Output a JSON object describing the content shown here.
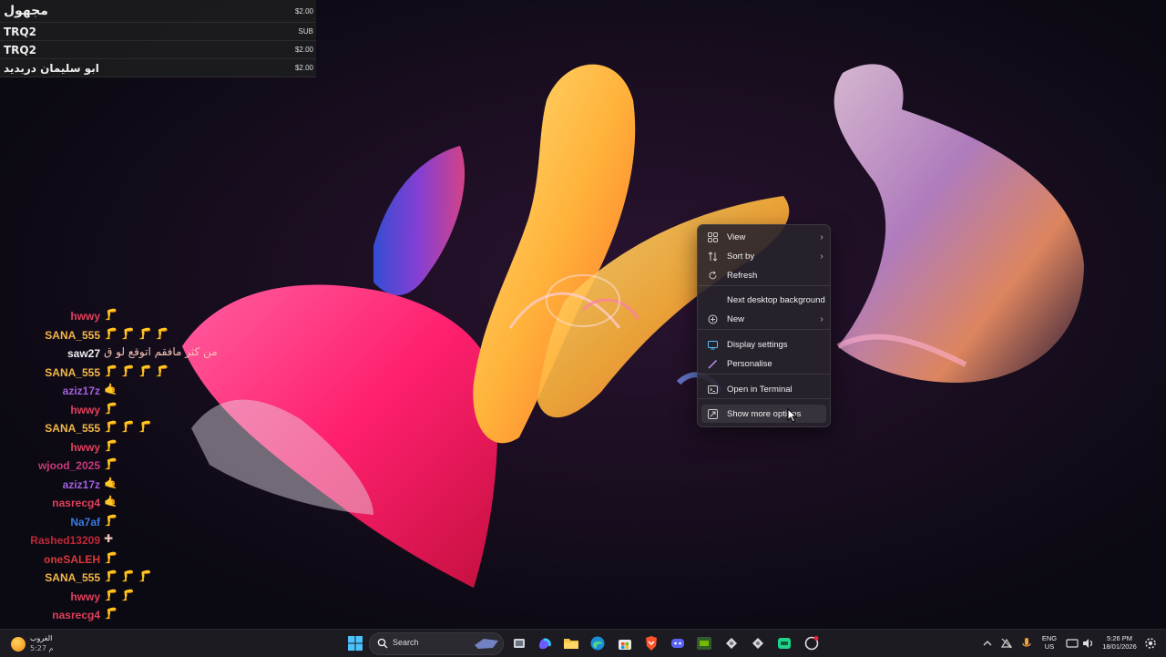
{
  "donations": [
    {
      "name": "مجهول",
      "amount": "$2.00"
    },
    {
      "name": "TRQ2",
      "amount": "SUB"
    },
    {
      "name": "TRQ2",
      "amount": "$2.00"
    },
    {
      "name": "ابو سليمان دربديد",
      "amount": "$2.00"
    }
  ],
  "chat": [
    {
      "user": "hwwy",
      "color": "#e0405c",
      "msg": "🦵"
    },
    {
      "user": "SANA_555",
      "color": "#f3b64a",
      "msg": "🦵 🦵 🦵 🦵"
    },
    {
      "user": "saw27",
      "color": "#eeeeee",
      "msg": "من كثر مافقم اتوقع لو ق"
    },
    {
      "user": "SANA_555",
      "color": "#f3b64a",
      "msg": "🦵 🦵 🦵 🦵"
    },
    {
      "user": "aziz17z",
      "color": "#a35ee0",
      "msg": "🤙"
    },
    {
      "user": "hwwy",
      "color": "#e0405c",
      "msg": "🦵"
    },
    {
      "user": "SANA_555",
      "color": "#f3b64a",
      "msg": "🦵 🦵 🦵"
    },
    {
      "user": "hwwy",
      "color": "#e0405c",
      "msg": "🦵"
    },
    {
      "user": "wjood_2025",
      "color": "#c83a7a",
      "msg": "🦵"
    },
    {
      "user": "aziz17z",
      "color": "#a35ee0",
      "msg": "🤙"
    },
    {
      "user": "nasrecg4",
      "color": "#e0405c",
      "msg": "🤙"
    },
    {
      "user": "Na7af",
      "color": "#3a7ae0",
      "msg": "🦵"
    },
    {
      "user": "Rashed13209",
      "color": "#c02838",
      "msg": "✚"
    },
    {
      "user": "oneSALEH",
      "color": "#d83a3a",
      "msg": "🦵"
    },
    {
      "user": "SANA_555",
      "color": "#f3b64a",
      "msg": "🦵 🦵 🦵"
    },
    {
      "user": "hwwy",
      "color": "#e0405c",
      "msg": "🦵 🦵"
    },
    {
      "user": "nasrecg4",
      "color": "#e0405c",
      "msg": "🦵"
    }
  ],
  "context_menu": {
    "items": [
      {
        "label": "View",
        "icon": "grid-icon",
        "has_submenu": true
      },
      {
        "label": "Sort by",
        "icon": "sort-icon",
        "has_submenu": true
      },
      {
        "label": "Refresh",
        "icon": "refresh-icon",
        "has_submenu": false
      },
      {
        "label": "Next desktop background",
        "icon": "",
        "has_submenu": false
      },
      {
        "label": "New",
        "icon": "new-icon",
        "has_submenu": true
      },
      {
        "label": "Display settings",
        "icon": "display-icon",
        "has_submenu": false
      },
      {
        "label": "Personalise",
        "icon": "brush-icon",
        "has_submenu": false
      },
      {
        "label": "Open in Terminal",
        "icon": "terminal-icon",
        "has_submenu": false
      },
      {
        "label": "Show more options",
        "icon": "more-options-icon",
        "has_submenu": false,
        "hovered": true
      }
    ]
  },
  "taskbar": {
    "weather_line1": "الغروب",
    "weather_line2": "5:27 م",
    "search_label": "Search",
    "lang_top": "ENG",
    "lang_bottom": "US",
    "time": "5:26 PM",
    "date": "18/01/2026",
    "pinned_icons": [
      "windows-start-icon",
      "task-view-icon",
      "copilot-icon",
      "file-explorer-icon",
      "edge-icon",
      "store-icon",
      "brave-icon",
      "discord-icon",
      "nvidia-icon",
      "app-icon-1",
      "app-icon-2",
      "app-icon-3",
      "app-icon-4"
    ]
  },
  "colors": {
    "menu_bg": "#28242c",
    "taskbar_bg": "#1d1b22",
    "desktop_bg": "#0d0a14"
  }
}
